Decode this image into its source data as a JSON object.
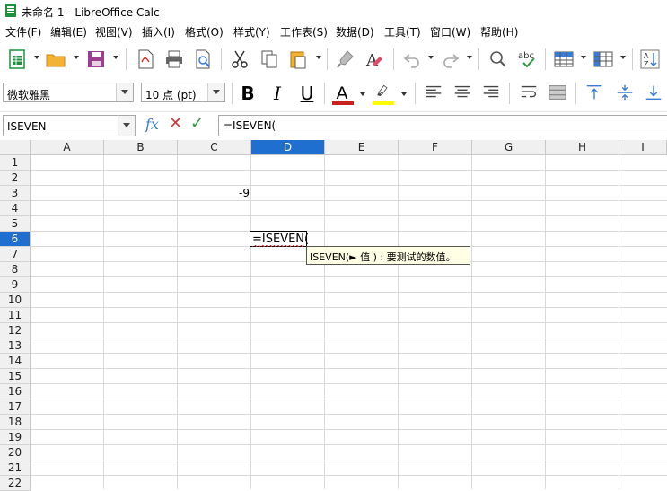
{
  "window": {
    "title": "未命名 1 - LibreOffice Calc"
  },
  "menu": [
    "文件(F)",
    "编辑(E)",
    "视图(V)",
    "插入(I)",
    "格式(O)",
    "样式(Y)",
    "工作表(S)",
    "数据(D)",
    "工具(T)",
    "窗口(W)",
    "帮助(H)"
  ],
  "format_toolbar": {
    "font_name": "微软雅黑",
    "font_size": "10 点 (pt)",
    "bold": "B",
    "italic": "I",
    "underline": "U",
    "font_color_glyph": "A",
    "font_color": "#c9211e",
    "highlight_color": "#ffff00"
  },
  "formula_bar": {
    "name_box": "ISEVEN",
    "fx_label": "fx",
    "cancel_glyph": "✕",
    "accept_glyph": "✓",
    "content": "=ISEVEN("
  },
  "sheet": {
    "columns": [
      "A",
      "B",
      "C",
      "D",
      "E",
      "F",
      "G",
      "H",
      "I"
    ],
    "selected_column": "D",
    "rows": [
      "1",
      "2",
      "3",
      "4",
      "5",
      "6",
      "7",
      "8",
      "9",
      "10",
      "11",
      "12",
      "13",
      "14",
      "15",
      "16",
      "17",
      "18",
      "19",
      "20",
      "21",
      "22"
    ],
    "selected_row": "6",
    "cell_c3": "-9",
    "edit_cell_text": "=ISEVEN(",
    "tooltip": "ISEVEN(► 值 ) : 要测试的数值。"
  }
}
